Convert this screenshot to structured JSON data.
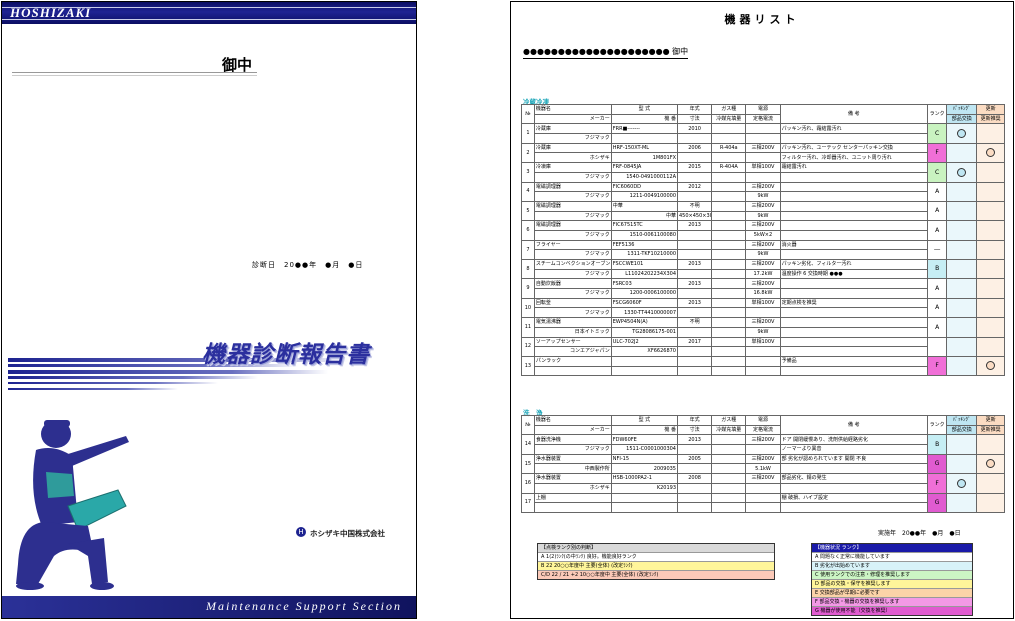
{
  "cover": {
    "brand": "HOSHIZAKI",
    "addressee": "御中",
    "diag_date": "診断日　20●●年　●月　●日",
    "title": "機器診断報告書",
    "company": "ホシザキ中国株式会社",
    "footer": "Maintenance  Support  Section"
  },
  "list": {
    "title": "機器リスト",
    "customer": "●●●●●●●●●●●●●●●●●●●●● 御中",
    "section1_label": "冷蔵冷凍",
    "section2_label": "洗　浄",
    "header": {
      "no": "№",
      "name": "機器名",
      "maker": "メーカー",
      "model": "型 式",
      "serial": "機 番",
      "year": "年式",
      "size": "寸法",
      "gas": "ガス種",
      "amount": "冷媒充填量",
      "power": "電源",
      "current": "定格電流",
      "remarks": "備 考",
      "rank": "ランク",
      "colB": "ﾊﾟｯｷﾝｸﾞ",
      "colB_sub": "部品交換",
      "colC": "更新",
      "colC_sub": "更新推奨"
    },
    "rows1": [
      {
        "no": "1",
        "name": "冷蔵庫",
        "maker": "フジマック",
        "model": "FRR■-------",
        "serial": "",
        "year": "2010",
        "size": "",
        "gas": "",
        "amount": "",
        "power": "",
        "current": "",
        "remarks": "パッキン汚れ、霜結露汚れ",
        "rank": "C",
        "b": true,
        "c": false
      },
      {
        "no": "2",
        "name": "冷蔵庫",
        "maker": "ホシザキ",
        "model": "HRF-150XT-ML",
        "serial": "1M801FX",
        "year": "2006",
        "size": "",
        "gas": "R-404a",
        "amount": "",
        "power": "三相200V",
        "current": "",
        "remarks": "パッキン汚れ、ユーテック センターパッキン交換",
        "remarks2": "フィルター汚れ、冷却器汚れ、ユニット周り汚れ",
        "rank": "F",
        "b": false,
        "c": true
      },
      {
        "no": "3",
        "name": "冷凍庫",
        "maker": "フジマック",
        "model": "FRF-0845JA",
        "serial": "1540-0491000112A",
        "year": "2015",
        "size": "",
        "gas": "R-404A",
        "amount": "",
        "power": "単相100V",
        "current": "",
        "remarks": "霜結露汚れ",
        "rank": "C",
        "b": true,
        "c": false
      },
      {
        "no": "4",
        "name": "電磁調理器",
        "maker": "フジマック",
        "model": "FIC6060DD",
        "serial": "1211-0049100000",
        "year": "2012",
        "size": "",
        "gas": "",
        "amount": "",
        "power": "三相200V",
        "current": "9kW",
        "remarks": "",
        "rank": "A",
        "b": false,
        "c": false
      },
      {
        "no": "5",
        "name": "電磁調理器",
        "maker": "フジマック",
        "model": "中華",
        "serial": "中華",
        "year": "不明",
        "size": "450×450×300",
        "gas": "",
        "amount": "",
        "power": "三相200V",
        "current": "9kW",
        "remarks": "",
        "rank": "A",
        "b": false,
        "c": false
      },
      {
        "no": "6",
        "name": "電磁調理器",
        "maker": "フジマック",
        "model": "FIC67515TC",
        "serial": "1510-0061100080",
        "year": "2013",
        "size": "",
        "gas": "",
        "amount": "",
        "power": "三相200V",
        "current": "5kW×2",
        "remarks": "",
        "rank": "A",
        "b": false,
        "c": false
      },
      {
        "no": "7",
        "name": "フライヤー",
        "maker": "フジマック",
        "model": "FEF5136",
        "serial": "1311-TKF10210000",
        "year": "",
        "size": "",
        "gas": "",
        "amount": "",
        "power": "三相200V",
        "current": "9kW",
        "remarks": "消火器",
        "rank": "―",
        "b": false,
        "c": false
      },
      {
        "no": "8",
        "name": "スチームコンベクションオーブン",
        "maker": "フジマック",
        "model": "FSCCWE101",
        "serial": "L11024202234X304",
        "year": "2013",
        "size": "",
        "gas": "",
        "amount": "",
        "power": "三相200V",
        "current": "17.2kW",
        "remarks": "パッキン劣化、フィルター汚れ",
        "remarks2": "温度操作 6 交換時期 ●●●",
        "rank": "B",
        "b": false,
        "c": false
      },
      {
        "no": "9",
        "name": "自動炊飯器",
        "maker": "フジマック",
        "model": "FSRC03",
        "serial": "1200-0006100000",
        "year": "2013",
        "size": "",
        "gas": "",
        "amount": "",
        "power": "三相200V",
        "current": "16.8kW",
        "remarks": "",
        "rank": "A",
        "b": false,
        "c": false
      },
      {
        "no": "10",
        "name": "回転釜",
        "maker": "フジマック",
        "model": "FSCG6060F",
        "serial": "1330-TT4410000007",
        "year": "2013",
        "size": "",
        "gas": "",
        "amount": "",
        "power": "単相100V",
        "current": "",
        "remarks": "定期点検を推奨",
        "rank": "A",
        "b": false,
        "c": false
      },
      {
        "no": "11",
        "name": "電気湯沸器",
        "maker": "日本イトミック",
        "model": "EWP4504N(A)",
        "serial": "TG28086175-001",
        "year": "不明",
        "size": "",
        "gas": "",
        "amount": "",
        "power": "三相200V",
        "current": "9kW",
        "remarks": "",
        "rank": "A",
        "b": false,
        "c": false
      },
      {
        "no": "12",
        "name": "ソーアップセンサー",
        "maker": "コンエアジャパン",
        "model": "ULC-702J2",
        "serial": "XF6626870",
        "year": "2017",
        "size": "",
        "gas": "",
        "amount": "",
        "power": "単相100V",
        "current": "",
        "remarks": "",
        "rank": "",
        "b": false,
        "c": false
      },
      {
        "no": "13",
        "name": "パンラック",
        "maker": "",
        "model": "",
        "serial": "",
        "year": "",
        "size": "",
        "gas": "",
        "amount": "",
        "power": "",
        "current": "",
        "remarks": "予備品",
        "rank": "F",
        "b": false,
        "c": true
      }
    ],
    "rows2": [
      {
        "no": "14",
        "name": "食器洗浄機",
        "maker": "フジマック",
        "model": "FDW60FE",
        "serial": "1511-C0001000304",
        "year": "2013",
        "size": "",
        "gas": "",
        "amount": "",
        "power": "三相200V",
        "current": "",
        "remarks": "ドア 開閉緩慢あり、洗剤供給経路劣化",
        "remarks2": "ノーマーより異音",
        "rank": "B",
        "b": false,
        "c": false
      },
      {
        "no": "15",
        "name": "浄水器装置",
        "maker": "中西製作所",
        "model": "NFI-15",
        "serial": "2009035",
        "year": "2005",
        "size": "",
        "gas": "",
        "amount": "",
        "power": "三相200V",
        "current": "5.1kW",
        "remarks": "部 劣化が認められています 開閉 不良",
        "rank": "G",
        "b": false,
        "c": true
      },
      {
        "no": "16",
        "name": "浄水器装置",
        "maker": "ホシザキ",
        "model": "HSB-1000PA2-1",
        "serial": "K20193",
        "year": "2008",
        "size": "",
        "gas": "",
        "amount": "",
        "power": "三相200V",
        "current": "",
        "remarks": "部品劣化、錆の発生",
        "rank": "F",
        "b": true,
        "c": false
      },
      {
        "no": "17",
        "name": "上棚",
        "maker": "",
        "model": "",
        "serial": "",
        "year": "",
        "size": "",
        "gas": "",
        "amount": "",
        "power": "",
        "current": "",
        "remarks": "棚 破損、ハイブ設定",
        "rank": "G",
        "b": false,
        "c": false
      }
    ],
    "implement": "実施年　20●●年　●月　●日",
    "legend_left": {
      "title": "【点検ランク別の判断】",
      "items": [
        "A  1(2)ﾗﾝｸ(の中ﾗﾝｸ)  良好。機能良好ランク",
        "B  22           20○○年度中 主要(全体)  (改定ﾗﾝｸ)",
        "C/D  22 / 21 +2   10○○年度中 主要(全体)  (改定ﾗﾝｸ)"
      ]
    },
    "legend_right": {
      "title": "【機器状況 ランク】",
      "items": [
        "A 問題なく正常に機能しています",
        "B 劣化が出始めています",
        "C 使用ランクでの注意・修理を推奨します",
        "D 部品の交換・保守を推奨します",
        "E 交換部品が早期に必要です",
        "F 部品交換・機器の交換を推奨します",
        "G 機器が使用不能（交換を推奨）"
      ]
    },
    "rank_colors": {
      "A": "#ffffff",
      "B": "#c6eef4",
      "C": "#c9f3c0",
      "F": "#f06fd7",
      "G": "#e05bd0",
      "―": "#ffffff"
    }
  }
}
